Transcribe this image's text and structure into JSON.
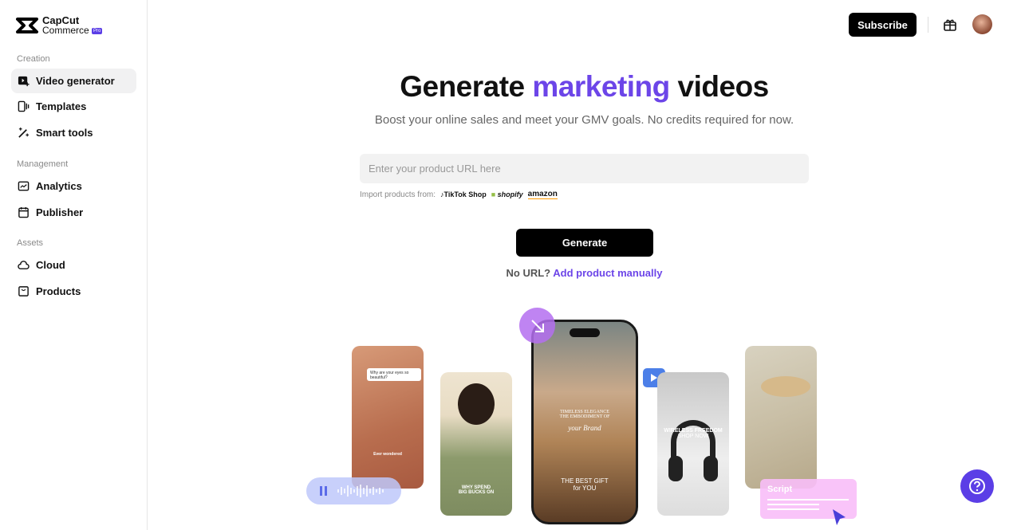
{
  "brand": {
    "line1": "CapCut",
    "line2": "Commerce",
    "badge": "Pro"
  },
  "sidebar": {
    "sections": [
      {
        "title": "Creation",
        "items": [
          {
            "label": "Video generator",
            "icon": "video-plus-icon",
            "active": true
          },
          {
            "label": "Templates",
            "icon": "templates-icon"
          },
          {
            "label": "Smart tools",
            "icon": "magic-wand-icon"
          }
        ]
      },
      {
        "title": "Management",
        "items": [
          {
            "label": "Analytics",
            "icon": "chart-icon"
          },
          {
            "label": "Publisher",
            "icon": "calendar-icon"
          }
        ]
      },
      {
        "title": "Assets",
        "items": [
          {
            "label": "Cloud",
            "icon": "cloud-icon"
          },
          {
            "label": "Products",
            "icon": "box-icon"
          }
        ]
      }
    ]
  },
  "header": {
    "subscribe": "Subscribe"
  },
  "hero": {
    "title_pre": "Generate ",
    "title_accent": "marketing",
    "title_post": " videos",
    "subtitle": "Boost your online sales and meet your GMV goals. No credits required for now.",
    "accent_color": "#6c45e8"
  },
  "form": {
    "url_placeholder": "Enter your product URL here",
    "import_label": "Import products from:",
    "platforms": [
      "TikTok Shop",
      "shopify",
      "amazon"
    ],
    "generate": "Generate",
    "no_url": "No URL?",
    "add_manual": "Add product manually"
  },
  "showcase": {
    "card1_question": "Why are your eyes so beautiful?",
    "card1_caption": "Ever wondered",
    "card2_caption1": "WHY SPEND",
    "card2_caption2": "BIG BUCKS ON",
    "phone_line1": "TIMELESS ELEGANCE",
    "phone_line2": "THE EMBODIMENT OF",
    "phone_brand": "your Brand",
    "phone_line3": "THE BEST GIFT",
    "phone_line4": "for YOU",
    "card4_line1": "WIRELESS FREEDOM",
    "card4_line2": "SHOP NOW",
    "script_label": "Script"
  }
}
